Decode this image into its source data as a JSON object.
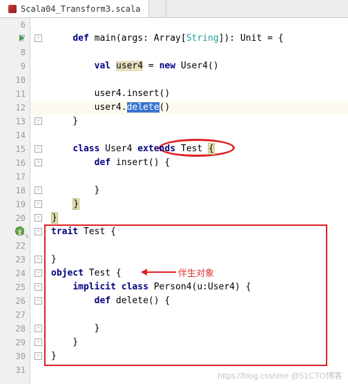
{
  "tabs": {
    "active": {
      "label": "Scala04_Transform3.scala"
    }
  },
  "lines": [
    {
      "n": 6,
      "html": ""
    },
    {
      "n": 7,
      "html": "    <span class='kw'>def</span> main(args: Array[<span class='str-type'>String</span>]): Unit = {",
      "run": true,
      "fold": "-"
    },
    {
      "n": 8,
      "html": ""
    },
    {
      "n": 9,
      "html": "        <span class='kw'>val</span> <span class='var-hl'>user4</span> = <span class='kw'>new</span> User4()"
    },
    {
      "n": 10,
      "html": ""
    },
    {
      "n": 11,
      "html": "        user4.insert()"
    },
    {
      "n": 12,
      "html": "        user4.<span class='sel'>delete</span>()",
      "caret": true
    },
    {
      "n": 13,
      "html": "    }",
      "fold": "-"
    },
    {
      "n": 14,
      "html": ""
    },
    {
      "n": 15,
      "html": "    <span class='kw'>class</span> User4 <span class='kw'>extends</span> Test <span class='brace-match'>{</span>",
      "fold": "-"
    },
    {
      "n": 16,
      "html": "        <span class='kw'>def</span> insert() {",
      "fold": "-"
    },
    {
      "n": 17,
      "html": ""
    },
    {
      "n": 18,
      "html": "        }",
      "fold": "-"
    },
    {
      "n": 19,
      "html": "    <span class='brace-match'>}</span>",
      "fold": "-"
    },
    {
      "n": 20,
      "html": "<span class='brace-match'>}</span>",
      "fold": "-"
    },
    {
      "n": 21,
      "html": "<span class='kw'>trait</span> Test {",
      "impl": true,
      "fold": "-"
    },
    {
      "n": 22,
      "html": ""
    },
    {
      "n": 23,
      "html": "}",
      "fold": "-"
    },
    {
      "n": 24,
      "html": "<span class='kw'>object</span> Test {",
      "fold": "-"
    },
    {
      "n": 25,
      "html": "    <span class='kw'>implicit</span> <span class='kw'>class</span> Person4(u:User4) {",
      "fold": "-"
    },
    {
      "n": 26,
      "html": "        <span class='kw'>def</span> delete() {",
      "fold": "-"
    },
    {
      "n": 27,
      "html": ""
    },
    {
      "n": 28,
      "html": "        }",
      "fold": "-"
    },
    {
      "n": 29,
      "html": "    }",
      "fold": "-"
    },
    {
      "n": 30,
      "html": "}",
      "fold": "-"
    },
    {
      "n": 31,
      "html": ""
    }
  ],
  "annotation": {
    "label": "伴生对象"
  },
  "watermark": "https://blog.csshine @51CTO博客"
}
